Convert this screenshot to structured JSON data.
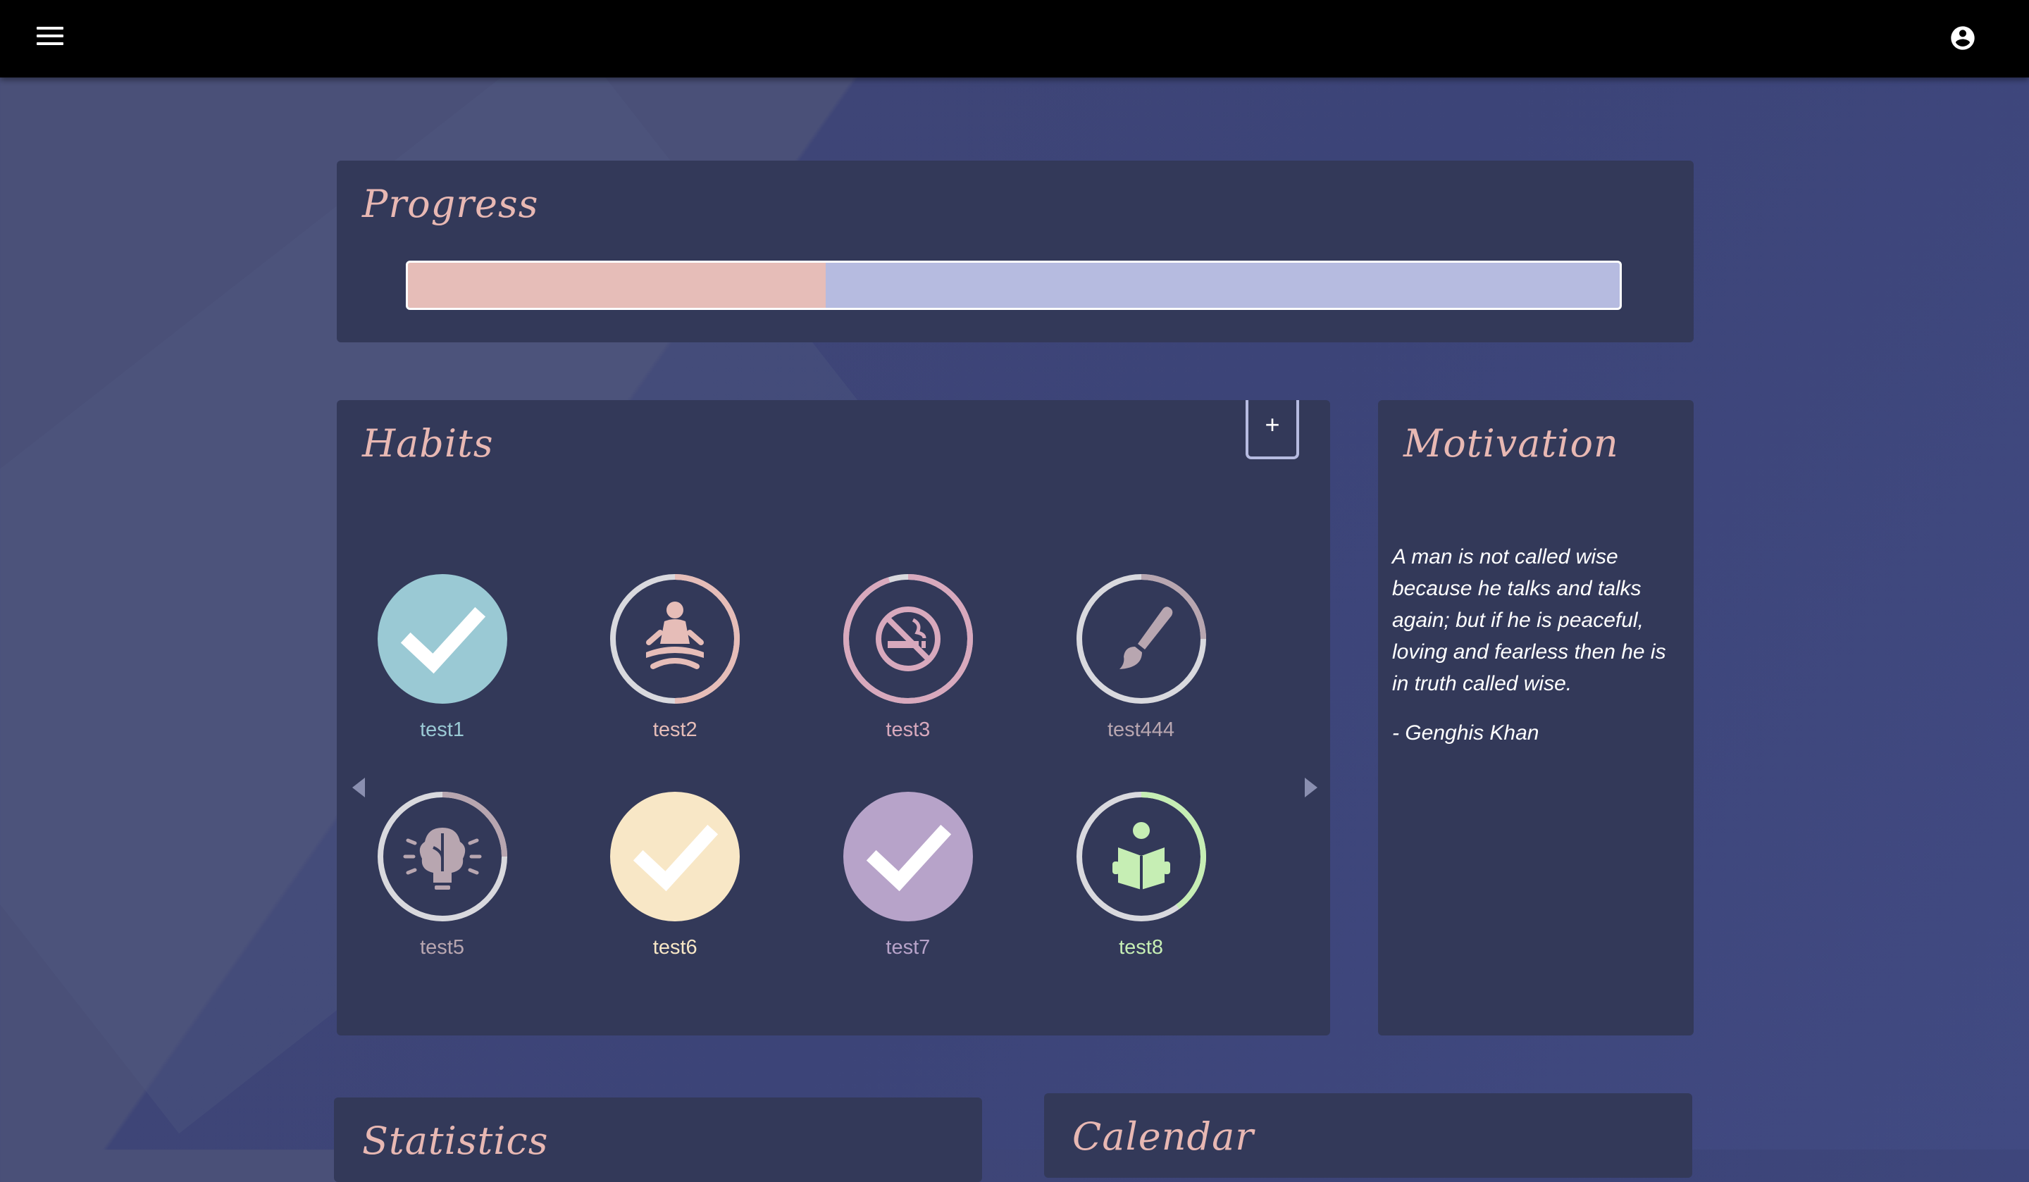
{
  "app": {
    "menu_icon": "hamburger-menu-icon",
    "account_icon": "account-circle-icon"
  },
  "progress": {
    "title": "Progress",
    "value_fraction": 0.345,
    "fill_color": "#e6bdb8",
    "track_color": "#b6bbe0"
  },
  "habits": {
    "title": "Habits",
    "add_label": "+",
    "items": [
      {
        "label": "test1",
        "icon": "check-icon",
        "completed": true,
        "color": "#9ac9d4",
        "progress": 1.0
      },
      {
        "label": "test2",
        "icon": "meditation-icon",
        "completed": false,
        "color": "#e6bdb8",
        "progress": 0.5
      },
      {
        "label": "test3",
        "icon": "no-smoking-icon",
        "completed": false,
        "color": "#d8a9bd",
        "progress": 0.95
      },
      {
        "label": "test444",
        "icon": "paintbrush-icon",
        "completed": false,
        "color": "#b8a6b0",
        "progress": 0.25
      },
      {
        "label": "test5",
        "icon": "brain-lightbulb-icon",
        "completed": false,
        "color": "#b8a6b0",
        "progress": 0.25
      },
      {
        "label": "test6",
        "icon": "check-icon",
        "completed": true,
        "color": "#f8e7c6",
        "progress": 1.0
      },
      {
        "label": "test7",
        "icon": "check-icon",
        "completed": true,
        "color": "#b7a3c9",
        "progress": 1.0
      },
      {
        "label": "test8",
        "icon": "reading-icon",
        "completed": false,
        "color": "#c6eeb4",
        "progress": 0.4
      }
    ]
  },
  "motivation": {
    "title": "Motivation",
    "quote": "A man is not called wise because he talks and talks again; but if he is peaceful, loving and fearless then he is in truth called wise.",
    "author": "- Genghis Khan"
  },
  "statistics": {
    "title": "Statistics"
  },
  "calendar": {
    "title": "Calendar"
  }
}
